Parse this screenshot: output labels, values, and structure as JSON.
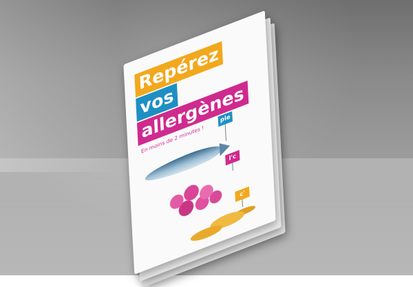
{
  "brochure": {
    "title_line_1": "Repérez",
    "title_line_2": "vos",
    "title_line_3": "allergènes",
    "subtitle": "En moins de 2 minutes !",
    "labels": [
      "ple",
      "l'c",
      "c'"
    ]
  },
  "colors": {
    "yellow": "#f2a81d",
    "blue": "#1e8fc4",
    "magenta": "#cf2a8e",
    "paper": "#fafafa",
    "background": "#8a8a8a"
  }
}
